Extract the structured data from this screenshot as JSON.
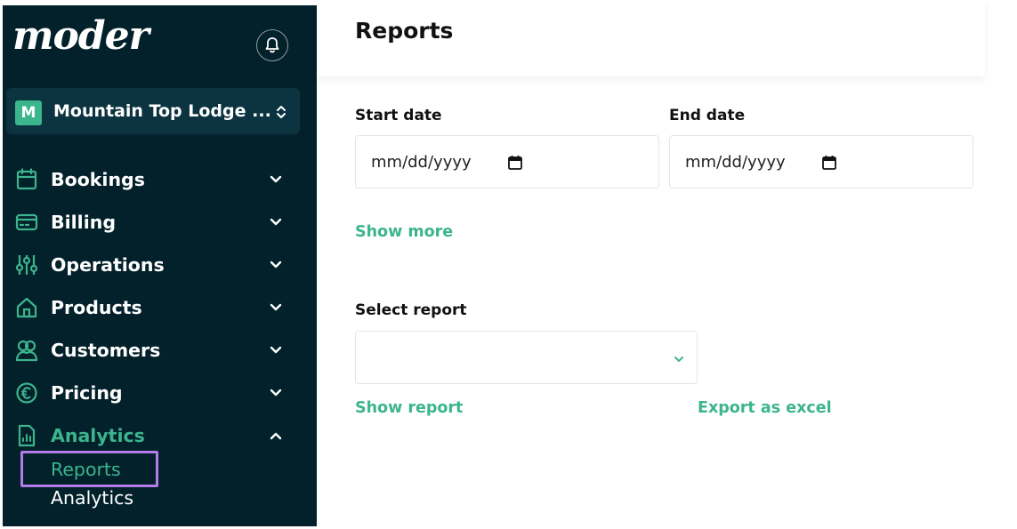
{
  "sidebar": {
    "logo": "moder",
    "org": {
      "badge": "M",
      "name": "Mountain Top Lodge ..."
    },
    "nav": [
      {
        "label": "Bookings",
        "icon": "calendar-icon",
        "expanded": false
      },
      {
        "label": "Billing",
        "icon": "credit-card-icon",
        "expanded": false
      },
      {
        "label": "Operations",
        "icon": "sliders-icon",
        "expanded": false
      },
      {
        "label": "Products",
        "icon": "home-icon",
        "expanded": false
      },
      {
        "label": "Customers",
        "icon": "users-icon",
        "expanded": false
      },
      {
        "label": "Pricing",
        "icon": "euro-icon",
        "expanded": false
      },
      {
        "label": "Analytics",
        "icon": "report-file-icon",
        "expanded": true
      }
    ],
    "analytics_sub": [
      {
        "label": "Reports",
        "active": true
      },
      {
        "label": "Analytics",
        "active": false
      }
    ]
  },
  "main": {
    "title": "Reports",
    "start_date": {
      "label": "Start date",
      "placeholder": "mm/dd/yyyy"
    },
    "end_date": {
      "label": "End date",
      "placeholder": "mm/dd/yyyy"
    },
    "show_more": "Show more",
    "select_report": {
      "label": "Select report",
      "value": ""
    },
    "show_report": "Show report",
    "export_excel": "Export as excel"
  },
  "colors": {
    "sidebar_bg": "#03212b",
    "accent": "#3cb58d",
    "highlight": "#b57bea"
  }
}
